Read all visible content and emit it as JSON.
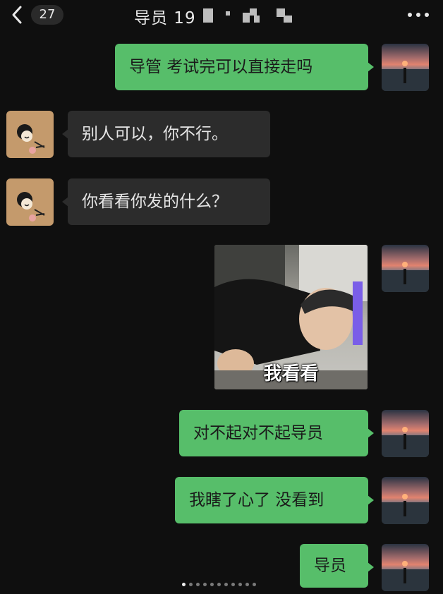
{
  "header": {
    "back_icon": "chevron-left-icon",
    "unread_count": "27",
    "title": "导员 19",
    "more_icon": "ellipsis-icon"
  },
  "messages": [
    {
      "sender": "me",
      "type": "text",
      "text": "导管 考试完可以直接走吗"
    },
    {
      "sender": "them",
      "type": "text",
      "text": "别人可以，你不行。"
    },
    {
      "sender": "them",
      "type": "text",
      "text": "你看看你发的什么？"
    },
    {
      "sender": "me",
      "type": "sticker",
      "caption": "我看看"
    },
    {
      "sender": "me",
      "type": "text",
      "text": "对不起对不起导员"
    },
    {
      "sender": "me",
      "type": "text",
      "text": "我瞎了心了 没看到"
    },
    {
      "sender": "me",
      "type": "text",
      "text": "导员"
    }
  ],
  "pager": {
    "count": 11,
    "active_index": 0
  },
  "colors": {
    "background": "#0f0f0f",
    "my_bubble": "#57be6a",
    "their_bubble": "#2c2c2c"
  }
}
